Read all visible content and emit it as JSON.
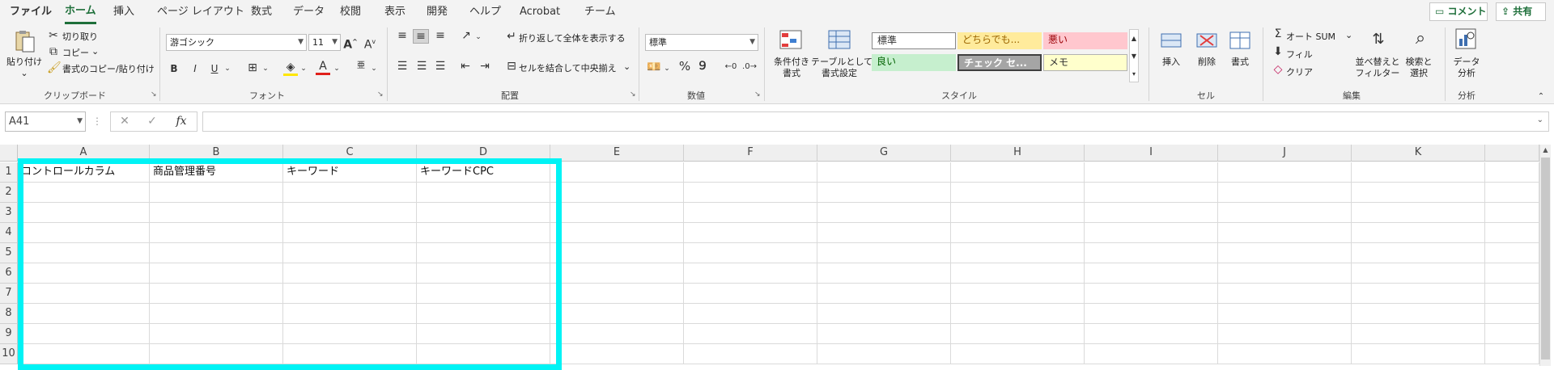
{
  "tabs": [
    "ファイル",
    "ホーム",
    "挿入",
    "ページ レイアウト",
    "数式",
    "データ",
    "校閲",
    "表示",
    "開発",
    "ヘルプ",
    "Acrobat",
    "チーム"
  ],
  "top_buttons": {
    "comment": "コメント",
    "share": "共有"
  },
  "clipboard": {
    "paste": "貼り付け",
    "cut": "切り取り",
    "copy": "コピー",
    "format_painter": "書式のコピー/貼り付け",
    "label": "クリップボード"
  },
  "font": {
    "name": "游ゴシック",
    "size": "11",
    "bold": "B",
    "italic": "I",
    "underline": "U",
    "font_color_glyph": "A",
    "label": "フォント"
  },
  "alignment": {
    "wrap": "折り返して全体を表示する",
    "merge": "セルを結合して中央揃え",
    "label": "配置"
  },
  "number": {
    "format": "標準",
    "percent": "%",
    "comma": "９",
    "label": "数値"
  },
  "styles": {
    "conditional": "条件付き\n書式",
    "table": "テーブルとして\n書式設定",
    "normal": "標準",
    "neutral": "どちらでも...",
    "bad": "悪い",
    "good": "良い",
    "check": "チェック セ...",
    "note": "メモ",
    "label": "スタイル"
  },
  "cells": {
    "insert": "挿入",
    "delete": "削除",
    "format": "書式",
    "label": "セル"
  },
  "editing": {
    "autosum": "オート SUM",
    "fill": "フィル",
    "clear": "クリア",
    "sort": "並べ替えと\nフィルター",
    "find": "検索と\n選択",
    "label": "編集"
  },
  "analysis": {
    "data": "データ\n分析",
    "label": "分析"
  },
  "formula_bar": {
    "name_box": "A41",
    "fx": "fx",
    "cancel": "✕",
    "enter": "✓",
    "value": ""
  },
  "columns": [
    "A",
    "B",
    "C",
    "D",
    "E",
    "F",
    "G",
    "H",
    "I",
    "J",
    "K"
  ],
  "rows": [
    "1",
    "2",
    "3",
    "4",
    "5",
    "6",
    "7",
    "8",
    "9",
    "10"
  ],
  "row1": [
    "コントロールカラム",
    "商品管理番号",
    "キーワード",
    "キーワードCPC"
  ],
  "colors": {
    "accent": "#1e6f3a",
    "highlight": "#00f3f5"
  }
}
